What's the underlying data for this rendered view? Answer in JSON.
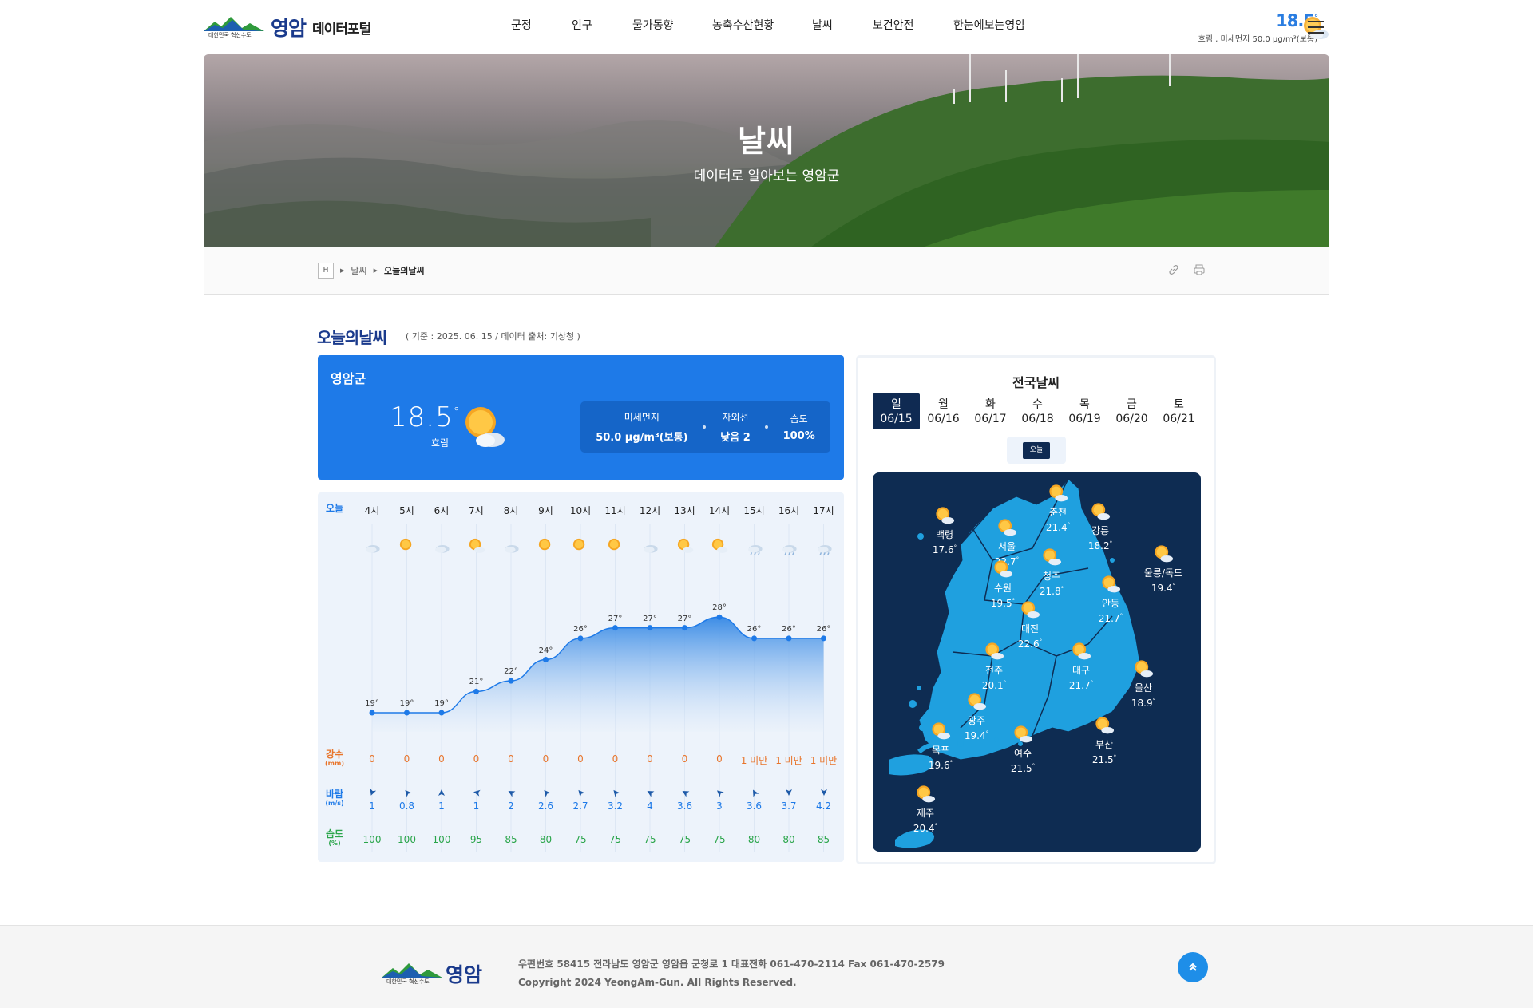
{
  "header": {
    "logo_sub": "대한민국 혁신수도",
    "logo_name": "영암",
    "portal_name": "데이터포털",
    "nav": [
      "군정",
      "인구",
      "물가동향",
      "농축수산현황",
      "날씨",
      "보건안전",
      "한눈에보는영암"
    ],
    "weather_temp": "18.5",
    "weather_unit": "°",
    "weather_sub": "흐림 , 미세먼지  50.0 μg/m³(보통)",
    "weather_icon": "sun-cloud-icon"
  },
  "hero": {
    "title": "날씨",
    "subtitle": "데이터로 알아보는 영암군"
  },
  "breadcrumb": {
    "home": "H",
    "items": [
      "날씨",
      "오늘의날씨"
    ]
  },
  "section": {
    "title": "오늘의날씨",
    "note": "( 기준 : 2025. 06. 15 / 데이터 출처: 기상청 )"
  },
  "current": {
    "region": "영암군",
    "temp": "18.5",
    "unit": "°",
    "condition": "흐림",
    "dust_label": "미세먼지",
    "dust_value": "50.0 μg/m³(보통)",
    "uv_label": "자외선",
    "uv_value": "낮음 2",
    "humidity_label": "습도",
    "humidity_value": "100%"
  },
  "hourly": {
    "today_label": "오늘",
    "rain_label": "강수",
    "rain_unit": "(mm)",
    "wind_label": "바람",
    "wind_unit": "(m/s)",
    "hum_label": "습도",
    "hum_unit": "(%)",
    "hours": [
      "4시",
      "5시",
      "6시",
      "7시",
      "8시",
      "9시",
      "10시",
      "11시",
      "12시",
      "13시",
      "14시",
      "15시",
      "16시",
      "17시"
    ],
    "icons": [
      "cloud",
      "sun",
      "cloud",
      "sun-cloud",
      "cloud",
      "sun",
      "sun",
      "sun",
      "cloud",
      "sun-cloud",
      "sun-cloud",
      "rain-cloud",
      "rain-cloud",
      "rain-cloud"
    ],
    "temps": [
      19,
      19,
      19,
      21,
      22,
      24,
      26,
      27,
      27,
      27,
      28,
      26,
      26,
      26
    ],
    "temp_unit": "°",
    "rain": [
      "0",
      "0",
      "0",
      "0",
      "0",
      "0",
      "0",
      "0",
      "0",
      "0",
      "0",
      "1 미만",
      "1 미만",
      "1 미만"
    ],
    "wind_dir_deg": [
      200,
      320,
      0,
      280,
      300,
      320,
      320,
      320,
      300,
      300,
      310,
      330,
      180,
      180
    ],
    "wind": [
      "1",
      "0.8",
      "1",
      "1",
      "2",
      "2.6",
      "2.7",
      "3.2",
      "4",
      "3.6",
      "3",
      "3.6",
      "3.7",
      "4.2"
    ],
    "humidity": [
      "100",
      "100",
      "100",
      "95",
      "85",
      "80",
      "75",
      "75",
      "75",
      "75",
      "75",
      "80",
      "80",
      "85"
    ],
    "colors": {
      "label": "#1e7ae8",
      "rain": "#e8742a",
      "humidity": "#2aa54a",
      "line": "#1e7ae8"
    }
  },
  "national": {
    "title": "전국날씨",
    "days": [
      {
        "dow": "일",
        "date": "06/15"
      },
      {
        "dow": "월",
        "date": "06/16"
      },
      {
        "dow": "화",
        "date": "06/17"
      },
      {
        "dow": "수",
        "date": "06/18"
      },
      {
        "dow": "목",
        "date": "06/19"
      },
      {
        "dow": "금",
        "date": "06/20"
      },
      {
        "dow": "토",
        "date": "06/21"
      }
    ],
    "today_button": "오늘",
    "cities": [
      {
        "name": "백령",
        "temp": "17.6"
      },
      {
        "name": "춘천",
        "temp": "21.4"
      },
      {
        "name": "강릉",
        "temp": "18.2"
      },
      {
        "name": "서울",
        "temp": "22.7"
      },
      {
        "name": "울릉/독도",
        "temp": "19.4"
      },
      {
        "name": "청주",
        "temp": "21.8"
      },
      {
        "name": "수원",
        "temp": "19.5"
      },
      {
        "name": "안동",
        "temp": "21.7"
      },
      {
        "name": "대전",
        "temp": "22.6"
      },
      {
        "name": "전주",
        "temp": "20.1"
      },
      {
        "name": "대구",
        "temp": "21.7"
      },
      {
        "name": "울산",
        "temp": "18.9"
      },
      {
        "name": "광주",
        "temp": "19.4"
      },
      {
        "name": "부산",
        "temp": "21.5"
      },
      {
        "name": "목포",
        "temp": "19.6"
      },
      {
        "name": "여수",
        "temp": "21.5"
      },
      {
        "name": "제주",
        "temp": "20.4"
      }
    ],
    "unit": "°"
  },
  "footer": {
    "logo_sub": "대한민국 혁신수도",
    "logo_name": "영암",
    "address": "우편번호 58415 전라남도 영암군 영암읍 군청로 1  대표전화 061-470-2114  Fax 061-470-2579",
    "copyright": "Copyright 2024 YeongAm-Gun. All Rights Reserved.",
    "top_icon": "double-chevron-up-icon"
  }
}
